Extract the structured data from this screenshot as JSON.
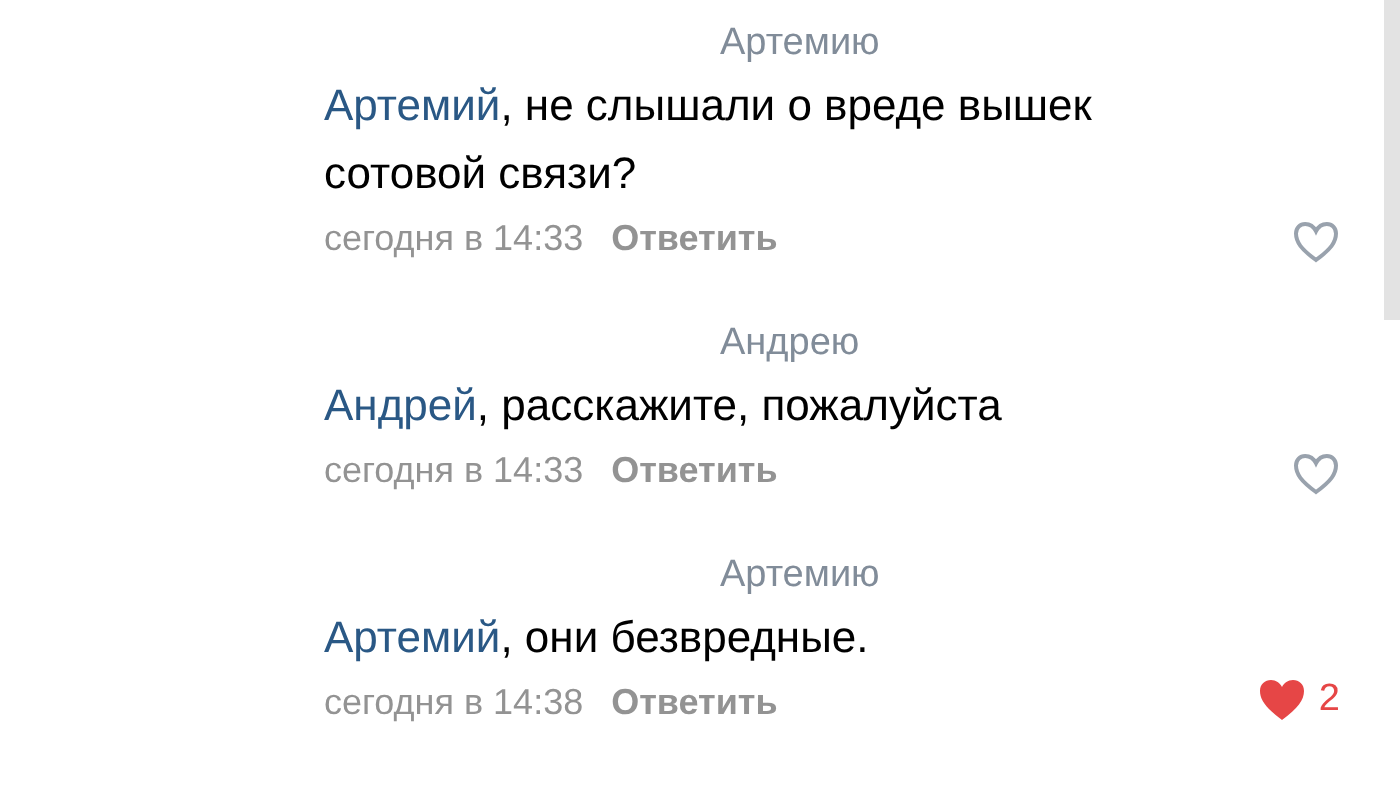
{
  "comments": [
    {
      "reply_to": "Артемию",
      "author": "Артемий",
      "text": ", не слышали о вреде вышек сотовой связи?",
      "time": "сегодня в 14:33",
      "reply_label": "Ответить",
      "liked": false
    },
    {
      "reply_to": "Андрею",
      "author": "Андрей",
      "text": ", расскажите, пожалуйста",
      "time": "сегодня в 14:33",
      "reply_label": "Ответить",
      "liked": false
    },
    {
      "reply_to": "Артемию",
      "author": "Артемий",
      "text": ", они безвредные.",
      "time": "сегодня в 14:38",
      "reply_label": "Ответить",
      "liked": true,
      "like_count": "2"
    }
  ]
}
